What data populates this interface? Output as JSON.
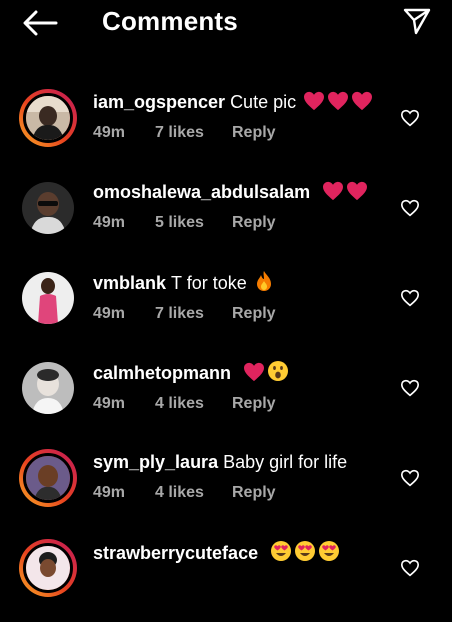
{
  "header": {
    "title": "Comments",
    "back_icon": "arrow-left-icon",
    "send_icon": "paper-plane-icon"
  },
  "colors": {
    "background": "#000000",
    "text": "#ffffff",
    "meta": "#a8a8a8",
    "story_ring": "#e8431f",
    "heart": "#e0245e"
  },
  "comments": [
    {
      "username": "iam_ogspencer",
      "text": "Cute pic",
      "emojis": [
        "red-heart",
        "red-heart",
        "red-heart"
      ],
      "time": "49m",
      "likes": "7 likes",
      "reply": "Reply",
      "story_ring": true
    },
    {
      "username": "omoshalewa_abdulsalam",
      "text": "",
      "emojis": [
        "red-heart",
        "red-heart"
      ],
      "time": "49m",
      "likes": "5 likes",
      "reply": "Reply",
      "story_ring": false
    },
    {
      "username": "vmblank",
      "text": "T for toke",
      "emojis": [
        "fire"
      ],
      "time": "49m",
      "likes": "7 likes",
      "reply": "Reply",
      "story_ring": false
    },
    {
      "username": "calmhetopmann",
      "text": "",
      "emojis": [
        "red-heart",
        "astonished-face"
      ],
      "time": "49m",
      "likes": "4 likes",
      "reply": "Reply",
      "story_ring": false
    },
    {
      "username": "sym_ply_laura",
      "text": "Baby girl for life",
      "emojis": [],
      "time": "49m",
      "likes": "4 likes",
      "reply": "Reply",
      "story_ring": true
    },
    {
      "username": "strawberrycuteface",
      "text": "",
      "emojis": [
        "heart-eyes-face",
        "heart-eyes-face",
        "heart-eyes-face"
      ],
      "time": "",
      "likes": "",
      "reply": "",
      "story_ring": true
    }
  ]
}
